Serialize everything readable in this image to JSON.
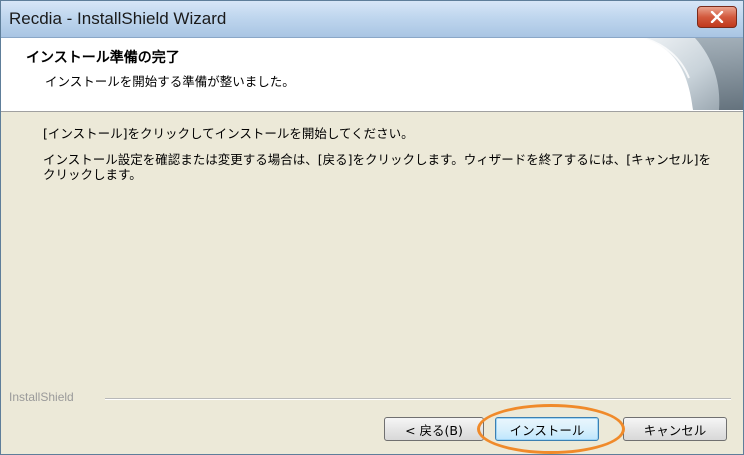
{
  "window": {
    "title": "Recdia - InstallShield Wizard"
  },
  "header": {
    "title": "インストール準備の完了",
    "subtitle": "インストールを開始する準備が整いました。"
  },
  "body": {
    "line1": "[インストール]をクリックしてインストールを開始してください。",
    "line2": "インストール設定を確認または変更する場合は、[戻る]をクリックします。ウィザードを終了するには、[キャンセル]をクリックします。"
  },
  "footer": {
    "brand": "InstallShield"
  },
  "buttons": {
    "back": "< 戻る(B)",
    "install": "インストール",
    "cancel": "キャンセル"
  },
  "colors": {
    "highlight": "#f08a2a",
    "close_button": "#c0381c"
  },
  "icons": {
    "close": "close-x-icon",
    "header_graphic": "installshield-curl-graphic"
  }
}
